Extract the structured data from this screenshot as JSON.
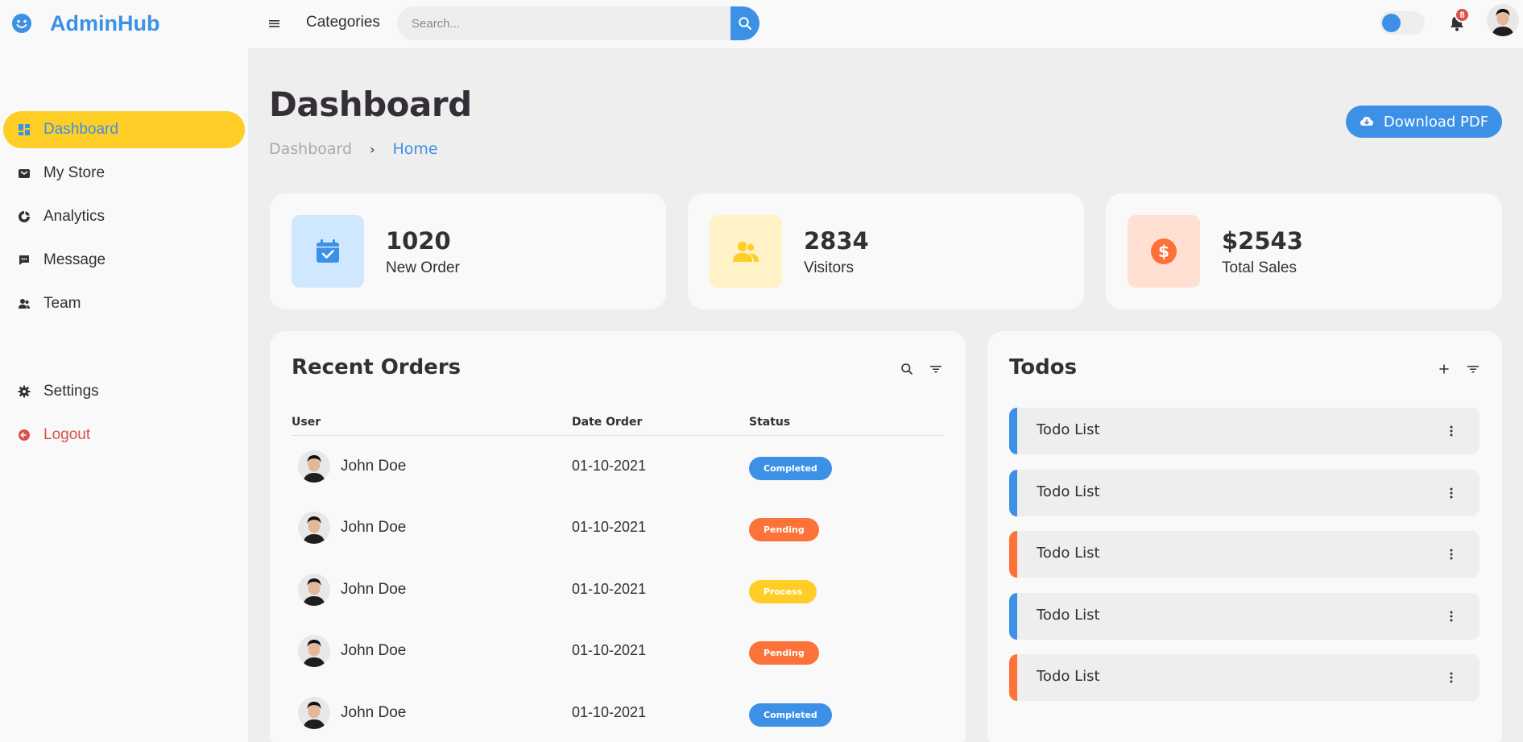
{
  "brand": {
    "name": "AdminHub"
  },
  "sidebar": {
    "items": [
      {
        "label": "Dashboard",
        "icon": "dashboard-icon",
        "active": true
      },
      {
        "label": "My Store",
        "icon": "shopping-bag-icon"
      },
      {
        "label": "Analytics",
        "icon": "doughnut-chart-icon"
      },
      {
        "label": "Message",
        "icon": "message-dots-icon"
      },
      {
        "label": "Team",
        "icon": "group-icon"
      }
    ],
    "bottom": [
      {
        "label": "Settings",
        "icon": "gear-icon"
      },
      {
        "label": "Logout",
        "icon": "logout-icon"
      }
    ]
  },
  "topnav": {
    "link": "Categories",
    "search_placeholder": "Search...",
    "notification_count": "8"
  },
  "main": {
    "title": "Dashboard",
    "breadcrumb": [
      "Dashboard",
      "Home"
    ],
    "download_label": "Download PDF"
  },
  "stats": [
    {
      "value": "1020",
      "label": "New Order",
      "icon": "calendar-check-icon"
    },
    {
      "value": "2834",
      "label": "Visitors",
      "icon": "group-icon"
    },
    {
      "value": "$2543",
      "label": "Total Sales",
      "icon": "dollar-circle-icon"
    }
  ],
  "orders": {
    "title": "Recent Orders",
    "columns": [
      "User",
      "Date Order",
      "Status"
    ],
    "rows": [
      {
        "user": "John Doe",
        "date": "01-10-2021",
        "status": "Completed"
      },
      {
        "user": "John Doe",
        "date": "01-10-2021",
        "status": "Pending"
      },
      {
        "user": "John Doe",
        "date": "01-10-2021",
        "status": "Process"
      },
      {
        "user": "John Doe",
        "date": "01-10-2021",
        "status": "Pending"
      },
      {
        "user": "John Doe",
        "date": "01-10-2021",
        "status": "Completed"
      }
    ]
  },
  "todos": {
    "title": "Todos",
    "items": [
      {
        "label": "Todo List",
        "state": "completed"
      },
      {
        "label": "Todo List",
        "state": "completed"
      },
      {
        "label": "Todo List",
        "state": "not-completed"
      },
      {
        "label": "Todo List",
        "state": "completed"
      },
      {
        "label": "Todo List",
        "state": "not-completed"
      }
    ]
  },
  "colors": {
    "blue": "#3c91e6",
    "yellow": "#ffce26",
    "orange": "#fd7238",
    "red": "#db504a",
    "light_blue": "#cfe8ff",
    "light_yellow": "#fff2c6",
    "light_orange": "#ffe0d3"
  }
}
